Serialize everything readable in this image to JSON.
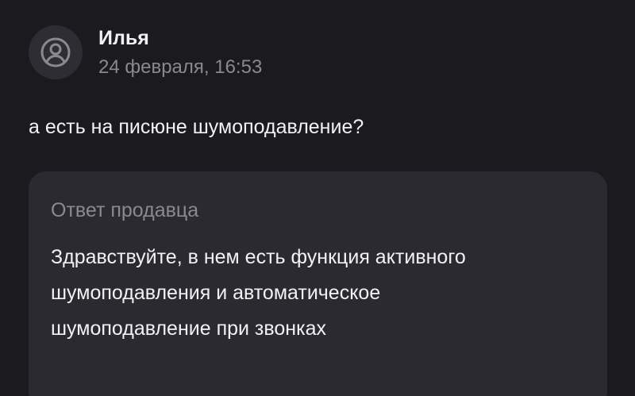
{
  "review": {
    "author": "Илья",
    "date": "24 февраля, 16:53",
    "comment": "а есть на писюне шумоподавление?",
    "avatar_icon": "user-avatar-icon"
  },
  "seller_reply": {
    "title": "Ответ продавца",
    "text": "Здравствуйте, в нем есть функция активного шумоподавления и автоматическое шумоподавление при звонках"
  },
  "colors": {
    "background": "#1b1a1e",
    "card": "#2b2a30",
    "avatar_bg": "#2e2d33",
    "primary_text": "#f2f2f4",
    "secondary_text": "#8a8990"
  }
}
